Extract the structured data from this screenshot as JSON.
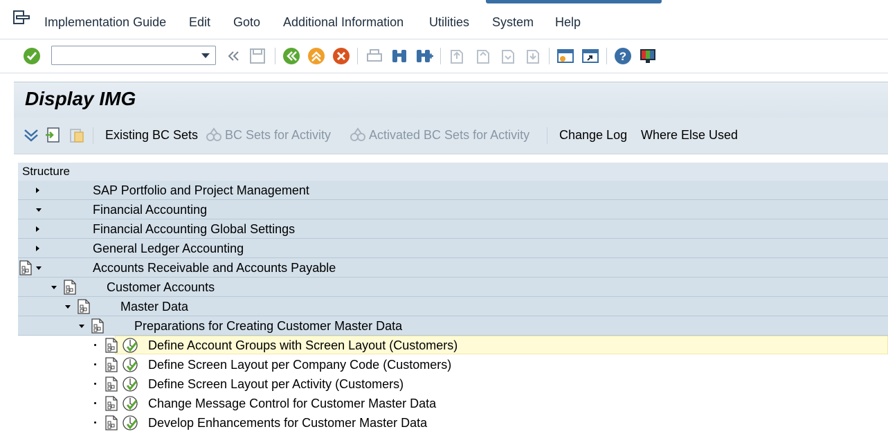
{
  "menubar": {
    "items": [
      "Implementation Guide",
      "Edit",
      "Goto",
      "Additional Information",
      "Utilities",
      "System",
      "Help"
    ]
  },
  "toolbar": {
    "command_field_value": "",
    "icons": [
      "enter-check-icon",
      "history-dropdown-icon",
      "collapse-arrows-icon",
      "save-icon",
      "back-icon",
      "exit-icon",
      "cancel-icon",
      "print-icon",
      "find-icon",
      "find-next-icon",
      "first-page-icon",
      "previous-page-icon",
      "next-page-icon",
      "last-page-icon",
      "create-session-icon",
      "generate-shortcut-icon",
      "help-icon",
      "customize-layout-icon"
    ]
  },
  "title": "Display IMG",
  "app_toolbar": {
    "existing_bc_sets": "Existing BC Sets",
    "bc_sets_for_activity": "BC Sets for Activity",
    "activated_bc_sets": "Activated BC Sets for Activity",
    "change_log": "Change Log",
    "where_else_used": "Where Else Used"
  },
  "tree": {
    "header": "Structure",
    "rows": [
      {
        "label": "SAP Portfolio and Project Management",
        "state": "collapsed",
        "level": 0,
        "doc": false,
        "exec": false
      },
      {
        "label": "Financial Accounting",
        "state": "expanded",
        "level": 0,
        "doc": false,
        "exec": false
      },
      {
        "label": "Financial Accounting Global Settings",
        "state": "collapsed",
        "level": 1,
        "doc": false,
        "exec": false
      },
      {
        "label": "General Ledger Accounting",
        "state": "collapsed",
        "level": 1,
        "doc": false,
        "exec": false
      },
      {
        "label": "Accounts Receivable and Accounts Payable",
        "state": "expanded",
        "level": 1,
        "doc": true,
        "exec": false
      },
      {
        "label": "Customer Accounts",
        "state": "expanded",
        "level": 2,
        "doc": true,
        "exec": false
      },
      {
        "label": "Master Data",
        "state": "expanded",
        "level": 3,
        "doc": true,
        "exec": false
      },
      {
        "label": "Preparations for Creating Customer Master Data",
        "state": "expanded",
        "level": 4,
        "doc": true,
        "exec": false
      },
      {
        "label": "Define Account Groups with Screen Layout (Customers)",
        "state": "leaf",
        "level": 5,
        "doc": true,
        "exec": true,
        "selected": true
      },
      {
        "label": "Define Screen Layout per Company Code (Customers)",
        "state": "leaf",
        "level": 5,
        "doc": true,
        "exec": true
      },
      {
        "label": "Define Screen Layout per Activity (Customers)",
        "state": "leaf",
        "level": 5,
        "doc": true,
        "exec": true
      },
      {
        "label": "Change Message Control for Customer Master Data",
        "state": "leaf",
        "level": 5,
        "doc": true,
        "exec": true
      },
      {
        "label": "Develop Enhancements for Customer Master Data",
        "state": "leaf",
        "level": 5,
        "doc": true,
        "exec": true
      }
    ]
  },
  "colors": {
    "accent": "#3a6fa6",
    "row_blue": "#d3e0ea",
    "selected_row": "#fffbd6",
    "ok_green": "#5aa832"
  }
}
